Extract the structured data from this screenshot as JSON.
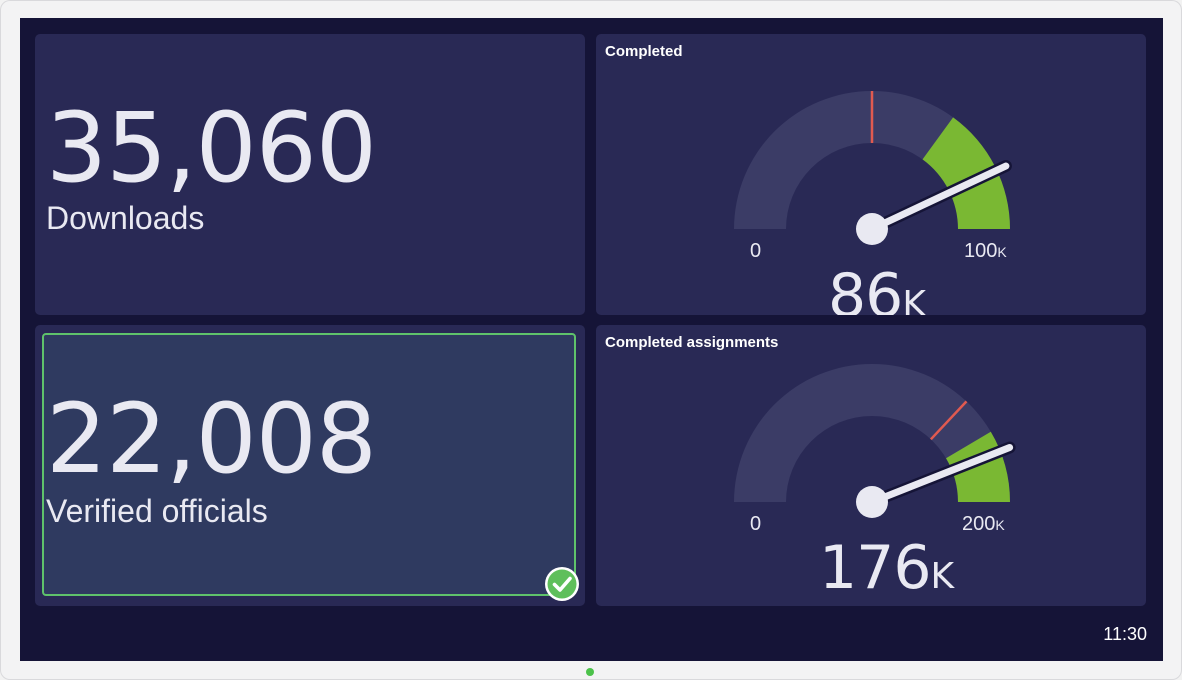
{
  "tiles": {
    "downloads": {
      "value": "35,060",
      "label": "Downloads"
    },
    "verified": {
      "value": "22,008",
      "label": "Verified officials",
      "status_icon": "check-circle-icon"
    },
    "completed": {
      "title": "Completed",
      "min_label": "0",
      "max_label": "100",
      "max_unit": "K",
      "value": "86",
      "value_unit": "K",
      "value_num": 86,
      "max_num": 100,
      "target_fraction": 0.5,
      "green_start_fraction": 0.7
    },
    "completed_assignments": {
      "title": "Completed assignments",
      "min_label": "0",
      "max_label": "200",
      "max_unit": "K",
      "value": "176",
      "value_unit": "K",
      "value_num": 176,
      "max_num": 200,
      "target_fraction": 0.74,
      "green_start_fraction": 0.83
    }
  },
  "colors": {
    "screen_bg": "#151437",
    "tile_bg": "#292955",
    "gauge_track": "#3b3c66",
    "gauge_green": "#7ab833",
    "gauge_target": "#e05a50",
    "needle": "#e9e9f2",
    "verified_border": "#5fc26b"
  },
  "clock": "11:30"
}
